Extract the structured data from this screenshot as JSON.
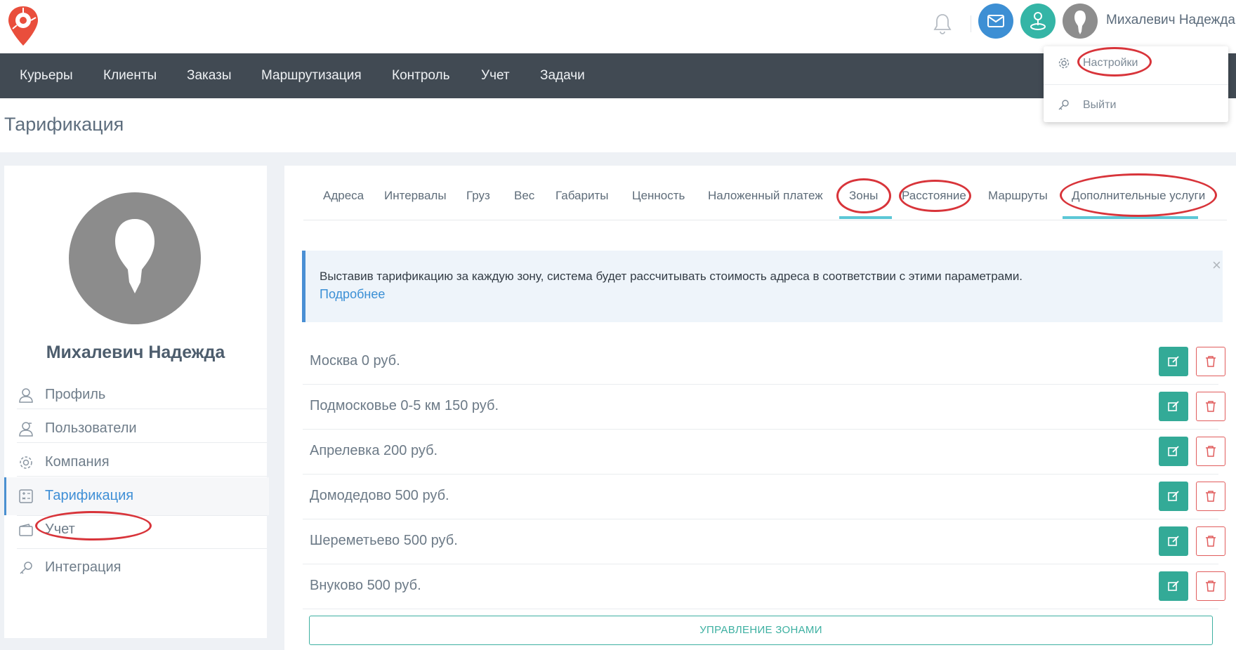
{
  "colors": {
    "accent": "#3d8fd4",
    "teal": "#34b5a6",
    "danger": "#e15c5c",
    "nav_bg": "#414a53",
    "annotation": "#d8343a"
  },
  "header": {
    "user_name": "Михалевич Надежда",
    "icons": [
      "bell-icon",
      "mail-icon",
      "route-icon",
      "avatar"
    ]
  },
  "nav": {
    "items": [
      "Курьеры",
      "Клиенты",
      "Заказы",
      "Маршрутизация",
      "Контроль",
      "Учет",
      "Задачи"
    ]
  },
  "user_menu": {
    "settings": "Настройки",
    "logout": "Выйти"
  },
  "page": {
    "title": "Тарификация"
  },
  "profile": {
    "name": "Михалевич Надежда",
    "menu": [
      {
        "label": "Профиль",
        "icon": "user-icon"
      },
      {
        "label": "Пользователи",
        "icon": "users-icon"
      },
      {
        "label": "Компания",
        "icon": "gear-icon"
      },
      {
        "label": "Тарификация",
        "icon": "calculator-icon",
        "active": true
      },
      {
        "label": "Учет",
        "icon": "wallet-icon"
      },
      {
        "label": "Интеграция",
        "icon": "key-icon"
      }
    ]
  },
  "tabs": [
    {
      "label": "Адреса"
    },
    {
      "label": "Интервалы"
    },
    {
      "label": "Груз"
    },
    {
      "label": "Вес"
    },
    {
      "label": "Габариты"
    },
    {
      "label": "Ценность"
    },
    {
      "label": "Наложенный платеж"
    },
    {
      "label": "Зоны",
      "active": true
    },
    {
      "label": "Расстояние"
    },
    {
      "label": "Маршруты"
    },
    {
      "label": "Дополнительные услуги",
      "active": true
    }
  ],
  "alert": {
    "text": "Выставив тарификацию за каждую зону, система будет рассчитывать стоимость адреса в соответствии с этими параметрами.",
    "link": "Подробнее",
    "close": "×"
  },
  "zones": [
    "Москва 0 руб.",
    "Подмосковье 0-5 км 150 руб.",
    "Апрелевка 200 руб.",
    "Домодедово 500 руб.",
    "Шереметьево 500 руб.",
    "Внуково 500 руб."
  ],
  "manage_zones": "УПРАВЛЕНИЕ ЗОНАМИ"
}
